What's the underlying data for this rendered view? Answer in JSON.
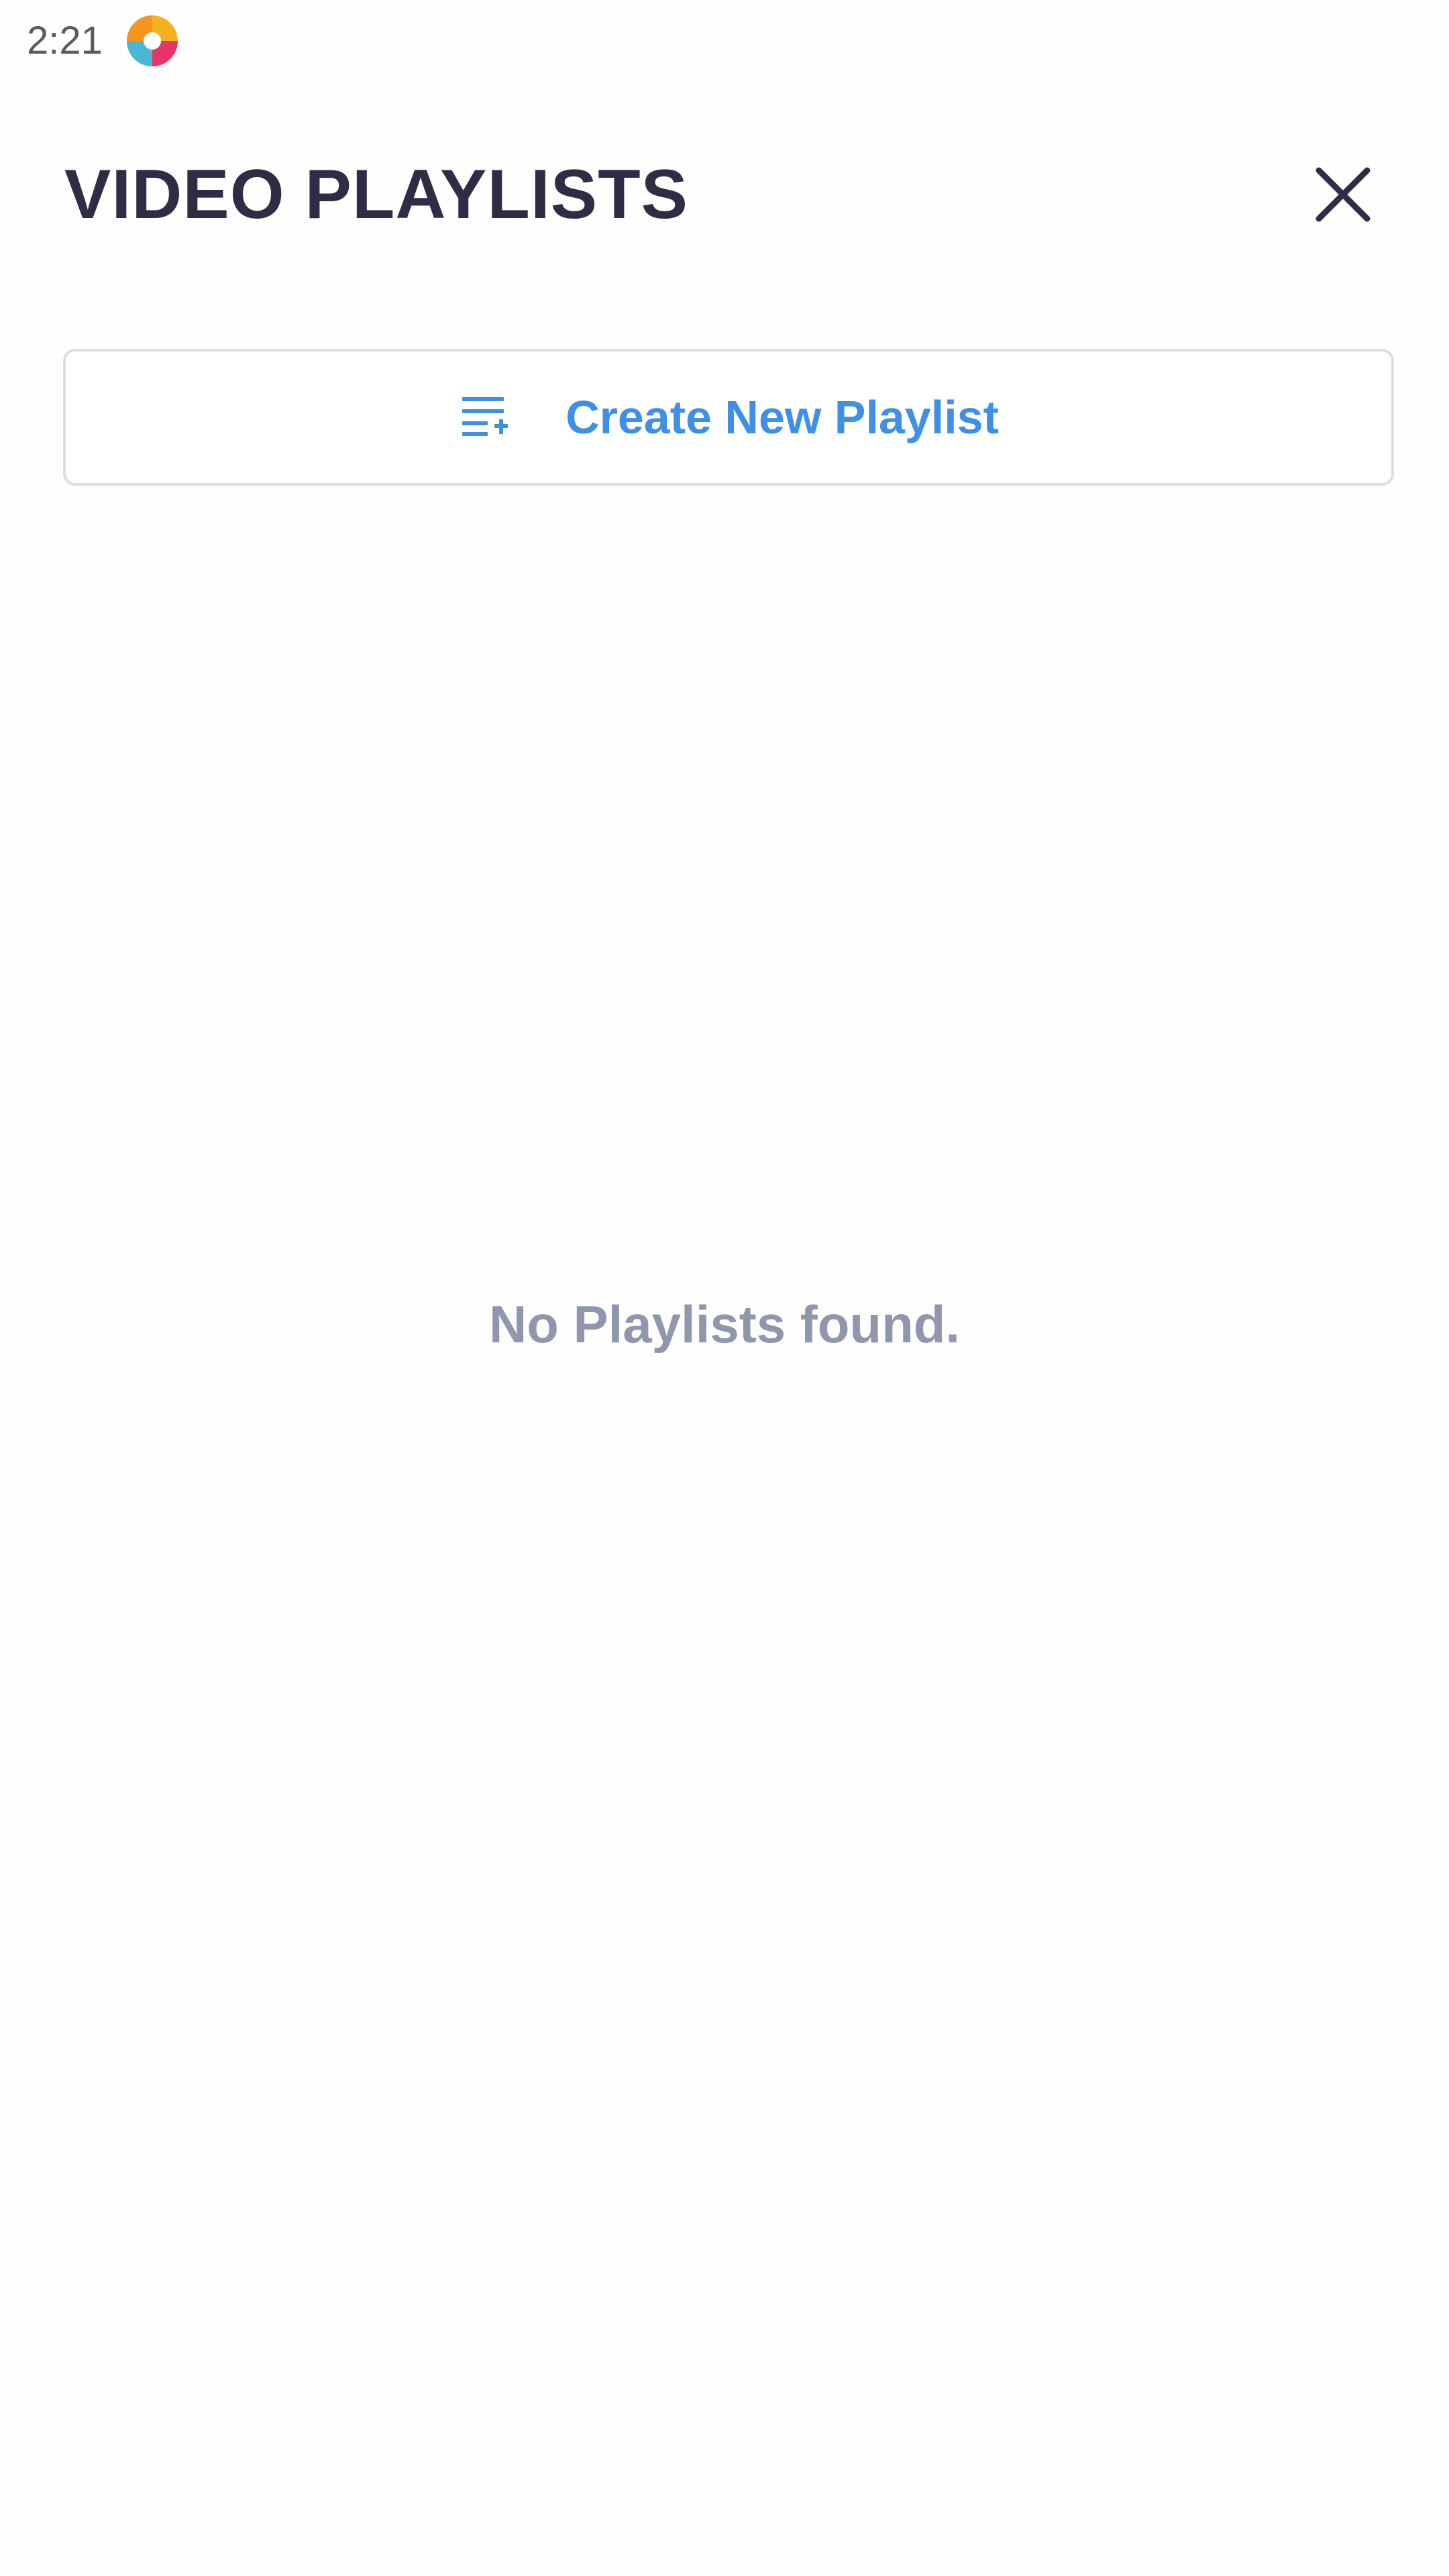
{
  "status_bar": {
    "time": "2:21",
    "app_icon": "app-logo-icon"
  },
  "header": {
    "title": "VIDEO PLAYLISTS",
    "close_icon": "close-icon"
  },
  "create_playlist": {
    "label": "Create New Playlist",
    "icon": "playlist-add-icon"
  },
  "empty_state": {
    "message": "No Playlists found."
  },
  "colors": {
    "title": "#2f2d45",
    "accent": "#3f8fe6",
    "muted": "#8f97ad",
    "border": "#dcdce2"
  }
}
